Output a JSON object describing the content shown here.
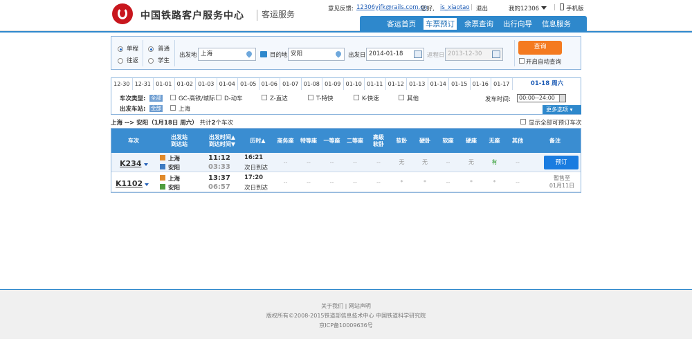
{
  "brand": {
    "title": "中国铁路客户服务中心",
    "sub": "客运服务"
  },
  "userbar": {
    "feedback_label": "意见反馈:",
    "feedback_email": "12306yjfk@rails.com.cn",
    "hello": "您好,",
    "username": "is_xiaotao",
    "logout": "退出",
    "my": "我的12306",
    "mobile": "手机版"
  },
  "nav": {
    "items": [
      "客运首页",
      "车票预订",
      "余票查询",
      "出行向导",
      "信息服务"
    ],
    "active": "车票预订"
  },
  "search": {
    "trip": [
      "单程",
      "往返"
    ],
    "trip_selected": "单程",
    "type": [
      "普通",
      "学生"
    ],
    "type_selected": "普通",
    "from_label": "出发地",
    "from": "上海",
    "to_label": "目的地",
    "to": "安阳",
    "date_label": "出发日",
    "date": "2014-01-18",
    "return_label": "返程日",
    "return_date": "2013-12-30",
    "query_button": "查询",
    "auto_query": "开启自动查询"
  },
  "dates": {
    "items": [
      "12-30",
      "12-31",
      "01-01",
      "01-02",
      "01-03",
      "01-04",
      "01-05",
      "01-06",
      "01-07",
      "01-08",
      "01-09",
      "01-10",
      "01-11",
      "01-12",
      "01-13",
      "01-14",
      "01-15",
      "01-16",
      "01-17"
    ],
    "selected": "01-18 周六"
  },
  "filters": {
    "type_label": "车次类型:",
    "all": "全部",
    "types": [
      "GC-高铁/城际",
      "D-动车",
      "Z-直达",
      "T-特快",
      "K-快速",
      "其他"
    ],
    "station_label": "出发车站:",
    "stations": [
      "上海"
    ],
    "time_label": "发车时间:",
    "time_value": "00:00--24:00",
    "more": "更多选项"
  },
  "summary": {
    "route": "上海 --> 安阳（1月18日 周六）",
    "count_prefix": "共计",
    "count": "2",
    "count_suffix": "个车次",
    "show_all": "显示全部可预订车次"
  },
  "table": {
    "headers": [
      "车次",
      "出发站\n到达站",
      "出发时间▲\n到达时间▼",
      "历时▲",
      "商务座",
      "特等座",
      "一等座",
      "二等座",
      "高级\n软卧",
      "软卧",
      "硬卧",
      "软座",
      "硬座",
      "无座",
      "其他",
      "备注"
    ],
    "rows": [
      {
        "train": "K234",
        "from": "上海",
        "to": "安阳",
        "dep": "11:12",
        "arr": "03:33",
        "dur": "16:21",
        "next": "次日到达",
        "seats": [
          "--",
          "--",
          "--",
          "--",
          "--",
          "无",
          "无",
          "--",
          "无",
          "有",
          "--"
        ],
        "note": "预订"
      },
      {
        "train": "K1102",
        "from": "上海",
        "to": "安阳",
        "dep": "13:37",
        "arr": "06:57",
        "dur": "17:20",
        "next": "次日到达",
        "seats": [
          "--",
          "--",
          "--",
          "--",
          "--",
          "*",
          "*",
          "--",
          "*",
          "*",
          "--"
        ],
        "note": "暂售至\n01月11日"
      }
    ]
  },
  "footer": {
    "links": "关于我们 | 网站声明",
    "copyright": "版权所有©2008-2015铁道部信息技术中心  中国铁道科学研究院",
    "icp": "京ICP备10009636号"
  },
  "colors": {
    "accent": "#2e88cc",
    "query": "#f47a20",
    "book": "#1a7ce0"
  }
}
